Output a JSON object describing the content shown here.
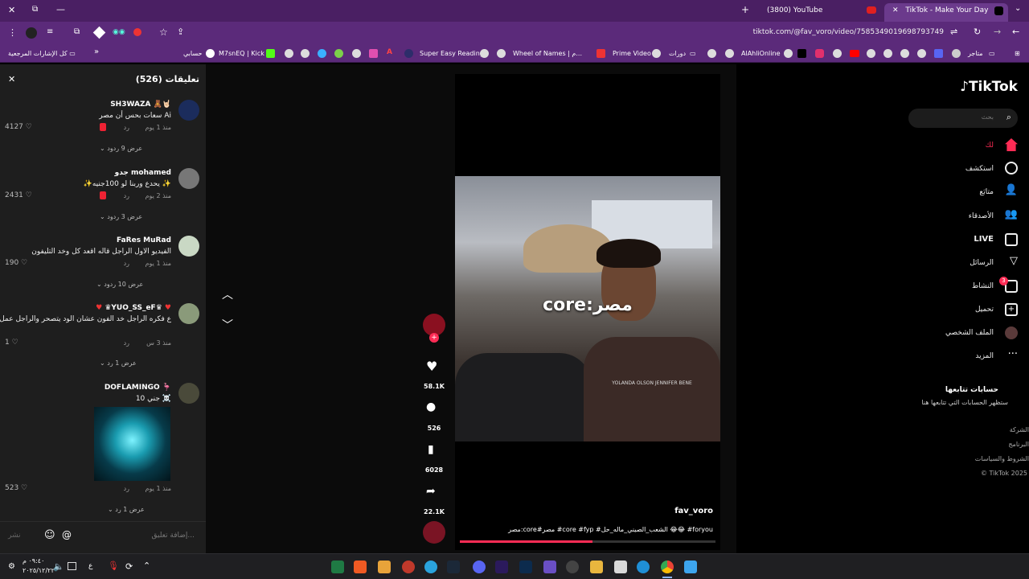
{
  "browser": {
    "tabs": [
      {
        "label": "(3800) YouTube"
      },
      {
        "label": "TikTok - Make Your Day"
      }
    ],
    "url": "tiktok.com/@fav_voro/video/7585349019698793749",
    "bookmarks": {
      "all": "كل الإشارات المرجعية",
      "items": [
        "حسابي",
        "M7snEQ | Kick",
        "Super Easy Reading",
        "Wheel of Names | م...",
        "Prime Video",
        "دورات",
        "AlAhliOnline",
        "متاجر"
      ]
    }
  },
  "comments": {
    "title": "تعليقات (526)",
    "items": [
      {
        "user": "SH3WAZA 🧸🤘🏻",
        "text": "سعات بحس أن مصر Ai",
        "time": "منذ 1 يوم",
        "reply": "رد",
        "likes": "4127",
        "replies_label": "عرض 9 ردود"
      },
      {
        "user": "جدو mohamed",
        "text": "✨يحدع وربنا لو 100جنيه ✨",
        "time": "منذ 2 يوم",
        "reply": "رد",
        "likes": "2431",
        "replies_label": "عرض 3 ردود"
      },
      {
        "user": "FaRes MuRad",
        "text": "الفيديو الاول الراجل قاله اقعد كل وخد التليفون",
        "time": "منذ 1 يوم",
        "reply": "رد",
        "likes": "190",
        "replies_label": "عرض 10 ردود"
      },
      {
        "user": "♛YUO_SS_eF♛",
        "text": "ع فكره الراجل خد الفون عشان الود يتصحر والراجل عمل خير",
        "time": "منذ 3 س",
        "reply": "رد",
        "likes": "1",
        "replies_label": "عرض 1 رد"
      },
      {
        "user": "DOFLAMINGO 🦩",
        "text": "10 جني ☠️",
        "time": "منذ 1 يوم",
        "reply": "رد",
        "likes": "523",
        "replies_label": "عرض 1 رد"
      }
    ],
    "input_placeholder": "إضافة تعليق...",
    "post_label": "نشر"
  },
  "video": {
    "overlay_text": "core:مصر",
    "shirt_text": "YOLANDA OLSON JENNIFER BENE",
    "author": "fav_voro",
    "caption": "مصر:core#مصر #core #fyp #الشعب_الصيني_ماله_حل 😂😂 #foryou",
    "likes": "58.1K",
    "comments": "526",
    "saves": "6028",
    "shares": "22.1K",
    "progress": 0.52
  },
  "sidebar": {
    "logo": "TikTok",
    "search_placeholder": "بحث",
    "nav": [
      "لك",
      "استكشف",
      "متابَع",
      "الأصدقاء",
      "LIVE",
      "الرسائل",
      "النشاط",
      "تحميل",
      "الملف الشخصي",
      "المزيد"
    ],
    "activity_badge": "3",
    "following_title": "حسابات تتابعها",
    "following_sub": "ستظهر الحسابات التي تتابعها هنا",
    "footer": [
      "الشركة",
      "البرنامج",
      "الشروط والسياسات",
      "© TikTok 2025"
    ]
  },
  "taskbar": {
    "time": "٠٩:٤٠ م",
    "date": "٢٠٢٥/١٢/٢٢",
    "lang": "ع"
  }
}
